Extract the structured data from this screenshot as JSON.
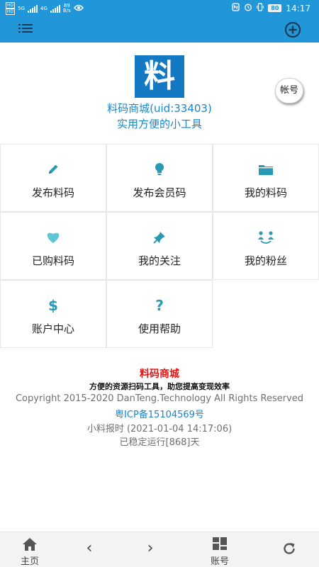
{
  "status_bar": {
    "net_tag_1": "HD",
    "net_tag_2": "HD",
    "net_gen_1": "5G",
    "net_gen_2": "4G",
    "speed_value": "89",
    "speed_unit": "B/s",
    "battery": "80",
    "time": "14:17"
  },
  "toolbar": {
    "menu_icon": "list-menu-icon",
    "add_icon": "plus-circle-icon"
  },
  "header": {
    "logo_char": "料",
    "account_button": "帐号",
    "app_name": "料码商城(uid:33403)",
    "slogan": "实用方便的小工具"
  },
  "grid": [
    {
      "label": "发布料码",
      "icon": "pencil-icon"
    },
    {
      "label": "发布会员码",
      "icon": "lightbulb-icon"
    },
    {
      "label": "我的料码",
      "icon": "folder-icon"
    },
    {
      "label": "已购料码",
      "icon": "heart-icon"
    },
    {
      "label": "我的关注",
      "icon": "pushpin-icon"
    },
    {
      "label": "我的粉丝",
      "icon": "users-icon"
    },
    {
      "label": "账户中心",
      "icon": "dollar-icon"
    },
    {
      "label": "使用帮助",
      "icon": "question-icon"
    }
  ],
  "footer": {
    "title": "料码商城",
    "subtitle": "方便的资源扫码工具，助您提高变现效率",
    "copyright": "Copyright 2015-2020 DanTeng.Technology All Rights Reserved",
    "icp": "粤ICP备15104569号",
    "report_time": "小料报时 (2021-01-04 14:17:06)",
    "uptime": "已稳定运行[868]天"
  },
  "bottom_nav": {
    "home": "主页",
    "back_glyph": "‹",
    "forward_glyph": "›",
    "account": "账号"
  },
  "colors": {
    "primary": "#2196d8",
    "accent_icon": "#2a9ab4",
    "logo_bg": "#1479c3",
    "footer_title": "#e21515",
    "link": "#1a86c6"
  }
}
